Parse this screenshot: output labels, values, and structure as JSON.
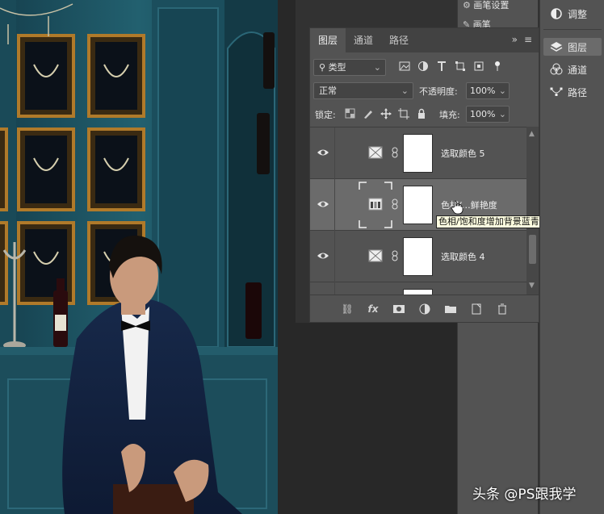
{
  "brush_panel": {
    "items": [
      {
        "label": "画笔设置"
      },
      {
        "label": "画笔"
      }
    ]
  },
  "layers_panel": {
    "tabs": [
      {
        "label": "图层",
        "active": true
      },
      {
        "label": "通道",
        "active": false
      },
      {
        "label": "路径",
        "active": false
      }
    ],
    "menu_icons": [
      "collapse-icon",
      "panel-menu-icon"
    ],
    "filter": {
      "label": "类型",
      "icons": [
        "image-filter-icon",
        "adjustment-filter-icon",
        "type-filter-icon",
        "shape-filter-icon",
        "smart-object-filter-icon",
        "filter-toggle-icon"
      ]
    },
    "blend_mode": "正常",
    "opacity_label": "不透明度:",
    "opacity_value": "100%",
    "lock_label": "锁定:",
    "fill_label": "填充:",
    "fill_value": "100%",
    "layers": [
      {
        "name": "选取颜色 5",
        "type": "selective-color",
        "visible": true,
        "selected": false
      },
      {
        "name": "色相/…鲜艳度",
        "type": "hue-saturation",
        "visible": true,
        "selected": true
      },
      {
        "name": "选取颜色 4",
        "type": "selective-color",
        "visible": true,
        "selected": false
      }
    ],
    "tooltip": "色相/饱和度增加背景蓝青的鲜艳度",
    "footer_icons": [
      "link-icon",
      "fx-icon",
      "mask-icon",
      "adjustment-icon",
      "group-icon",
      "new-layer-icon",
      "trash-icon"
    ],
    "footer_fx": "fx"
  },
  "right_dock": {
    "items": [
      {
        "label": "调整",
        "icon": "adjustments-icon",
        "active": false
      },
      {
        "label": "图层",
        "icon": "layers-icon",
        "active": true
      },
      {
        "label": "通道",
        "icon": "channels-icon",
        "active": false
      },
      {
        "label": "路径",
        "icon": "paths-icon",
        "active": false
      }
    ]
  },
  "watermark": "头条 @PS跟我学",
  "colors": {
    "panel_bg": "#535353",
    "selected_layer": "#6b6b6b",
    "workspace": "#282828",
    "tooltip_bg": "#ffffe1",
    "photo_wall": "#1f5566"
  }
}
